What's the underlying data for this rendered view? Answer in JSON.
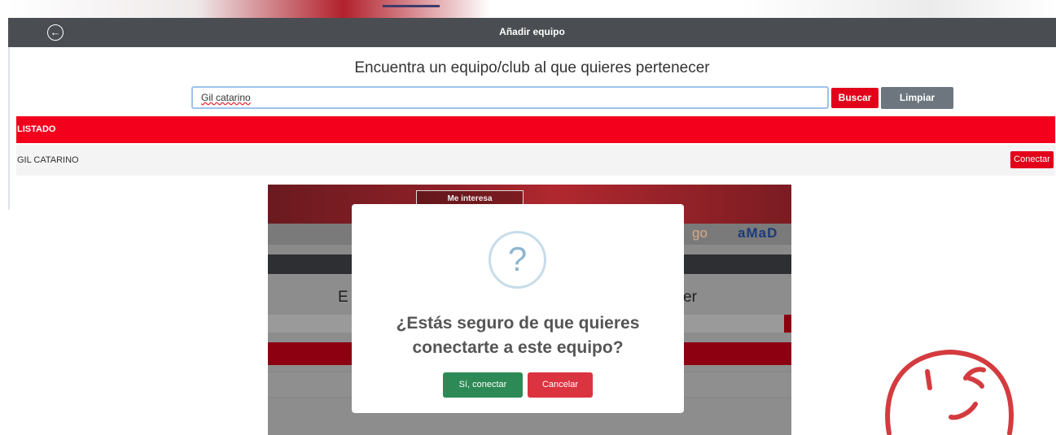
{
  "header": {
    "title": "Añadir equipo",
    "back_icon": "arrow-left-circle-icon"
  },
  "main": {
    "heading": "Encuentra un equipo/club al que quieres pertenecer",
    "search": {
      "value": "Gil catarino"
    },
    "buttons": {
      "search": "Buscar",
      "clear": "Limpiar"
    }
  },
  "list": {
    "header": "LISTADO",
    "rows": [
      {
        "name": "GIL CATARINO",
        "action": "Conectar"
      }
    ]
  },
  "background": {
    "banner_button": "Me interesa",
    "brand_1": "go",
    "brand_2": "aMaD",
    "heading_left": "E",
    "heading_right": "er"
  },
  "modal": {
    "icon": "question-icon",
    "icon_glyph": "?",
    "title": "¿Estás seguro de que quieres conectarte a este equipo?",
    "confirm": "Sí, conectar",
    "cancel": "Cancelar"
  },
  "colors": {
    "brand_red": "#e2001a",
    "header_gray": "#4a4d52",
    "clear_gray": "#6d767e",
    "confirm_green": "#2d8a56",
    "cancel_red": "#dc3340",
    "wink_red": "#d43b3f"
  },
  "decor": {
    "wink_icon": "wink-face-icon"
  }
}
